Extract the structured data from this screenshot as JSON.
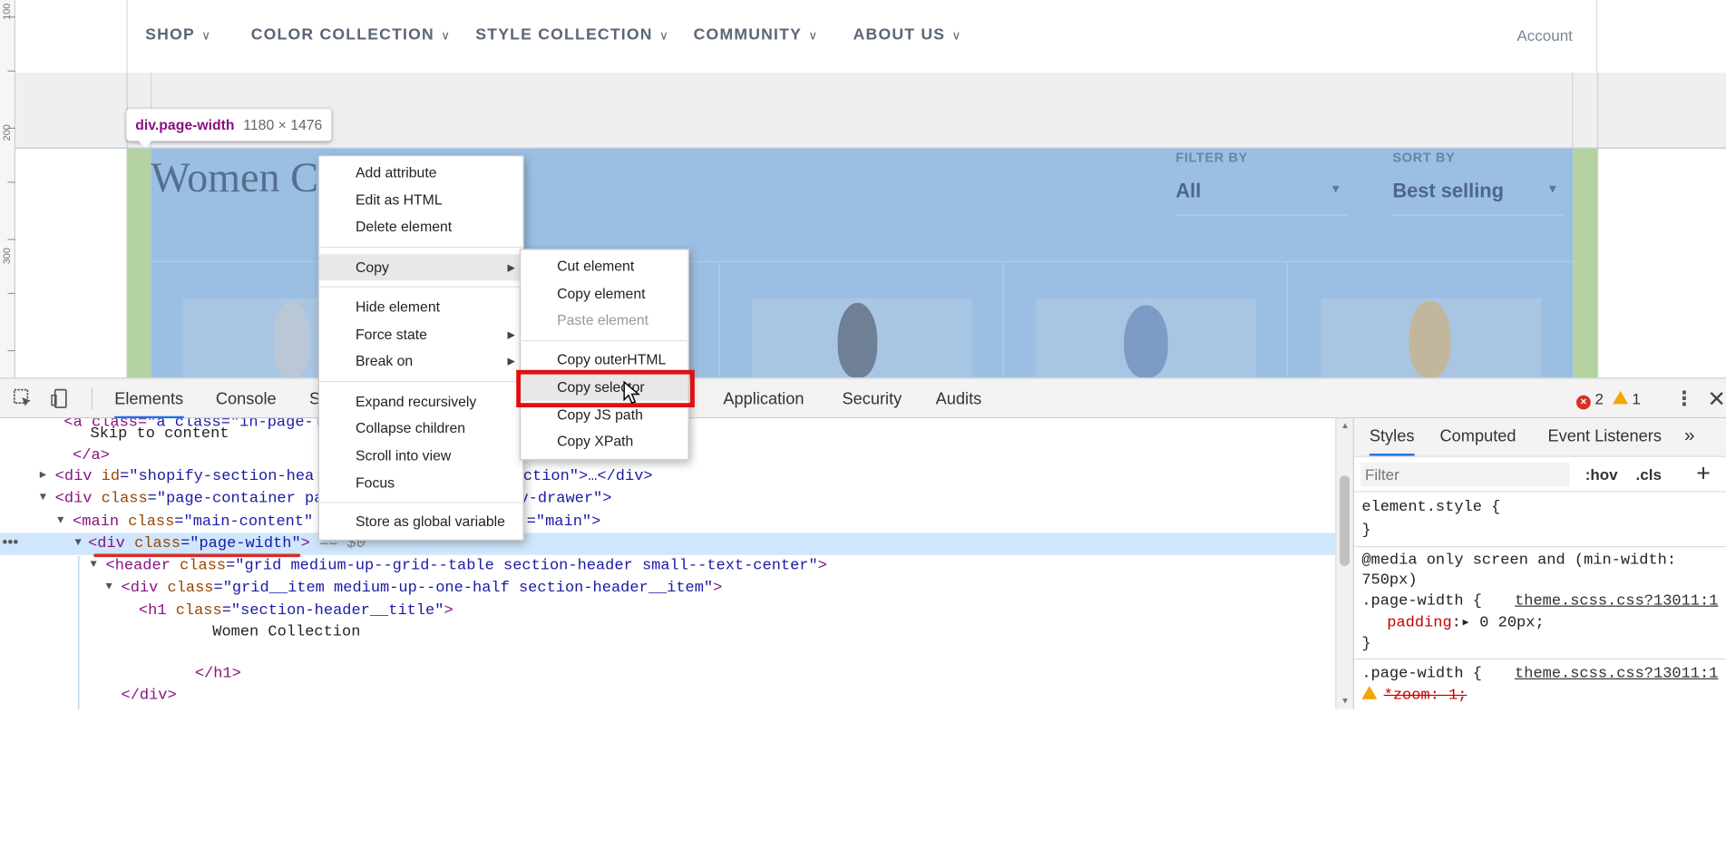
{
  "site": {
    "nav": [
      {
        "label": "SHOP"
      },
      {
        "label": "COLOR COLLECTION"
      },
      {
        "label": "STYLE COLLECTION"
      },
      {
        "label": "COMMUNITY"
      },
      {
        "label": "ABOUT US"
      }
    ],
    "account": "Account",
    "heading": "Women C",
    "filter_label": "FILTER BY",
    "filter_value": "All",
    "sort_label": "SORT BY",
    "sort_value": "Best selling"
  },
  "ruler": {
    "marks": [
      "100",
      "200",
      "300"
    ]
  },
  "tooltip": {
    "tag": "div.page-width",
    "dims": "1180 × 1476"
  },
  "context_menu": {
    "items": [
      "Add attribute",
      "Edit as HTML",
      "Delete element",
      "Copy",
      "Hide element",
      "Force state",
      "Break on",
      "Expand recursively",
      "Collapse children",
      "Scroll into view",
      "Focus",
      "Store as global variable"
    ],
    "copy_submenu": [
      "Cut element",
      "Copy element",
      "Paste element",
      "Copy outerHTML",
      "Copy selector",
      "Copy JS path",
      "Copy XPath"
    ]
  },
  "devtools": {
    "tabs": [
      "Elements",
      "Console",
      "S",
      "Application",
      "Security",
      "Audits"
    ],
    "errors": "2",
    "warnings": "1",
    "styles_tabs": [
      "Styles",
      "Computed",
      "Event Listeners",
      "»"
    ],
    "filter_placeholder": "Filter",
    "hov": ":hov",
    "cls": ".cls",
    "add_rule": "+"
  },
  "dom": {
    "l0": "\"a class=\"in-page-link visu",
    "l1": "Skip to content",
    "l2": "</a>",
    "l3_a": "<div ",
    "l3_b": "id",
    "l3_c": "=\"shopify-section-hea",
    "l3_d": "ction\">…</div>",
    "l4_a": "<div ",
    "l4_b": "class",
    "l4_c": "=\"page-container pa",
    "l4_d": "y-drawer\">",
    "l5_a": "<main ",
    "l5_b": "class",
    "l5_c": "=\"main-content\"",
    "l5_d": "=\"main\">",
    "l6_a": "<div ",
    "l6_b": "class",
    "l6_c": "=\"page-width\"",
    "l6_d": ">",
    "l6_e": " == $0",
    "l7_a": "<header ",
    "l7_b": "class",
    "l7_c": "=\"grid medium-up--grid--table section-header small--text-center\"",
    "l7_d": ">",
    "l8_a": "<div ",
    "l8_b": "class",
    "l8_c": "=\"grid__item medium-up--one-half section-header__item\"",
    "l8_d": ">",
    "l9_a": "<h1 ",
    "l9_b": "class",
    "l9_c": "=\"section-header__title\"",
    "l9_d": ">",
    "l10": "Women Collection",
    "l11": "</h1>",
    "l12": "</div>"
  },
  "styles": {
    "s1": "element.style {",
    "s2": "}",
    "s3": "@media only screen and (min-width:",
    "s4": "750px)",
    "s5": ".page-width {",
    "s5_link": "theme.scss.css?13011:1",
    "s6_prop": "padding",
    "s6_val": ":▸ 0 20px;",
    "s7": "}",
    "s8": ".page-width {",
    "s8_link": "theme.scss.css?13011:1",
    "s9": "*zoom: 1;"
  },
  "colors": {
    "accent": "#1a73e8",
    "highlight": "#9bbfe3",
    "annotation": "#e01010"
  }
}
